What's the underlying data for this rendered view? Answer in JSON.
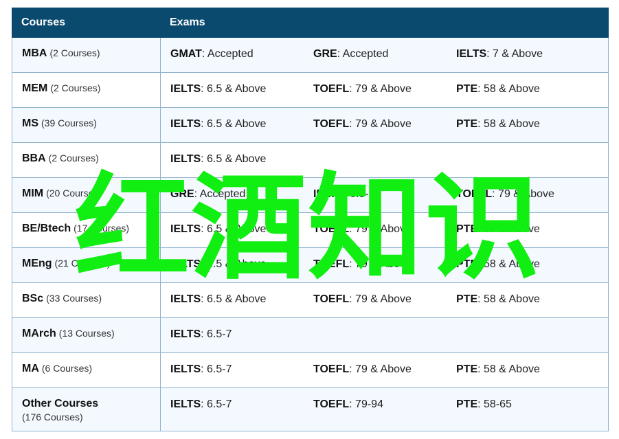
{
  "header": {
    "courses": "Courses",
    "exams": "Exams"
  },
  "rows": [
    {
      "name": "MBA",
      "count": "(2 Courses)",
      "exams": [
        {
          "name": "GMAT",
          "req": ": Accepted"
        },
        {
          "name": "GRE",
          "req": ": Accepted"
        },
        {
          "name": "IELTS",
          "req": ": 7 & Above"
        }
      ]
    },
    {
      "name": "MEM",
      "count": "(2 Courses)",
      "exams": [
        {
          "name": "IELTS",
          "req": ": 6.5 & Above"
        },
        {
          "name": "TOEFL",
          "req": ": 79 & Above"
        },
        {
          "name": "PTE",
          "req": ": 58 & Above"
        }
      ]
    },
    {
      "name": "MS",
      "count": "(39 Courses)",
      "exams": [
        {
          "name": "IELTS",
          "req": ": 6.5 & Above"
        },
        {
          "name": "TOEFL",
          "req": ": 79 & Above"
        },
        {
          "name": "PTE",
          "req": ": 58 & Above"
        }
      ]
    },
    {
      "name": "BBA",
      "count": "(2 Courses)",
      "exams": [
        {
          "name": "IELTS",
          "req": ": 6.5 & Above"
        }
      ]
    },
    {
      "name": "MIM",
      "count": "(20 Courses)",
      "exams": [
        {
          "name": "GRE",
          "req": ": Accepted"
        },
        {
          "name": "IELTS",
          "req": ": 6.5-7"
        },
        {
          "name": "TOEFL",
          "req": ": 79 & Above"
        }
      ]
    },
    {
      "name": "BE/Btech",
      "count": "(17 Courses)",
      "exams": [
        {
          "name": "IELTS",
          "req": ": 6.5 & Above"
        },
        {
          "name": "TOEFL",
          "req": ": 79 & Above"
        },
        {
          "name": "PTE",
          "req": ": 58 & Above"
        }
      ]
    },
    {
      "name": "MEng",
      "count": "(21 Courses)",
      "exams": [
        {
          "name": "IELTS",
          "req": ": 6.5 & Above"
        },
        {
          "name": "TOEFL",
          "req": ": 79 & Above"
        },
        {
          "name": "PTE",
          "req": ": 58 & Above"
        }
      ]
    },
    {
      "name": "BSc",
      "count": "(33 Courses)",
      "exams": [
        {
          "name": "IELTS",
          "req": ": 6.5 & Above"
        },
        {
          "name": "TOEFL",
          "req": ": 79 & Above"
        },
        {
          "name": "PTE",
          "req": ": 58 & Above"
        }
      ]
    },
    {
      "name": "MArch",
      "count": "(13 Courses)",
      "exams": [
        {
          "name": "IELTS",
          "req": ": 6.5-7"
        }
      ]
    },
    {
      "name": "MA",
      "count": "(6 Courses)",
      "exams": [
        {
          "name": "IELTS",
          "req": ": 6.5-7"
        },
        {
          "name": "TOEFL",
          "req": ": 79 & Above"
        },
        {
          "name": "PTE",
          "req": ": 58 & Above"
        }
      ]
    },
    {
      "name": "Other Courses",
      "count": "(176 Courses)",
      "exams": [
        {
          "name": "IELTS",
          "req": ": 6.5-7"
        },
        {
          "name": "TOEFL",
          "req": ": 79-94"
        },
        {
          "name": "PTE",
          "req": ": 58-65"
        }
      ]
    }
  ],
  "watermark": {
    "text": "红酒知识",
    "color": "#11ee11"
  },
  "colors": {
    "header_bg": "#0b4a6f",
    "row_alt_bg": "#f3f9fe",
    "border": "#8fb3cf"
  }
}
